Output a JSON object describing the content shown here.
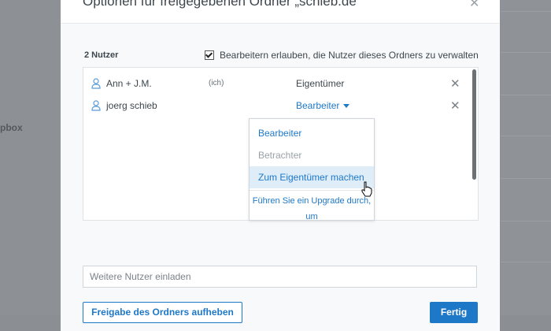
{
  "background": {
    "side_text": "pbox"
  },
  "dialog": {
    "title": "Optionen für freigegebenen Ordner „schieb.de“",
    "close_symbol": "✕",
    "member_count": "2 Nutzer",
    "allow_editors_label": "Bearbeitern erlauben, die Nutzer dieses Ordners zu verwalten",
    "allow_editors_checked": true,
    "members": [
      {
        "name": "Ann + J.M.",
        "tag": "(ich)",
        "role": "Eigentümer",
        "remove_symbol": "✕"
      },
      {
        "name": "joerg schieb",
        "tag": "",
        "role": "Bearbeiter",
        "remove_symbol": "✕"
      }
    ],
    "role_menu": {
      "items": [
        "Bearbeiter",
        "Betrachter",
        "Zum Eigentümer machen"
      ],
      "upgrade_text": "Führen Sie ein Upgrade durch, um"
    },
    "invite_placeholder": "Weitere Nutzer einladen",
    "unshare_label": "Freigabe des Ordners aufheben",
    "done_label": "Fertig"
  },
  "colors": {
    "accent": "#1e78c8",
    "highlight": "#deedf8"
  }
}
